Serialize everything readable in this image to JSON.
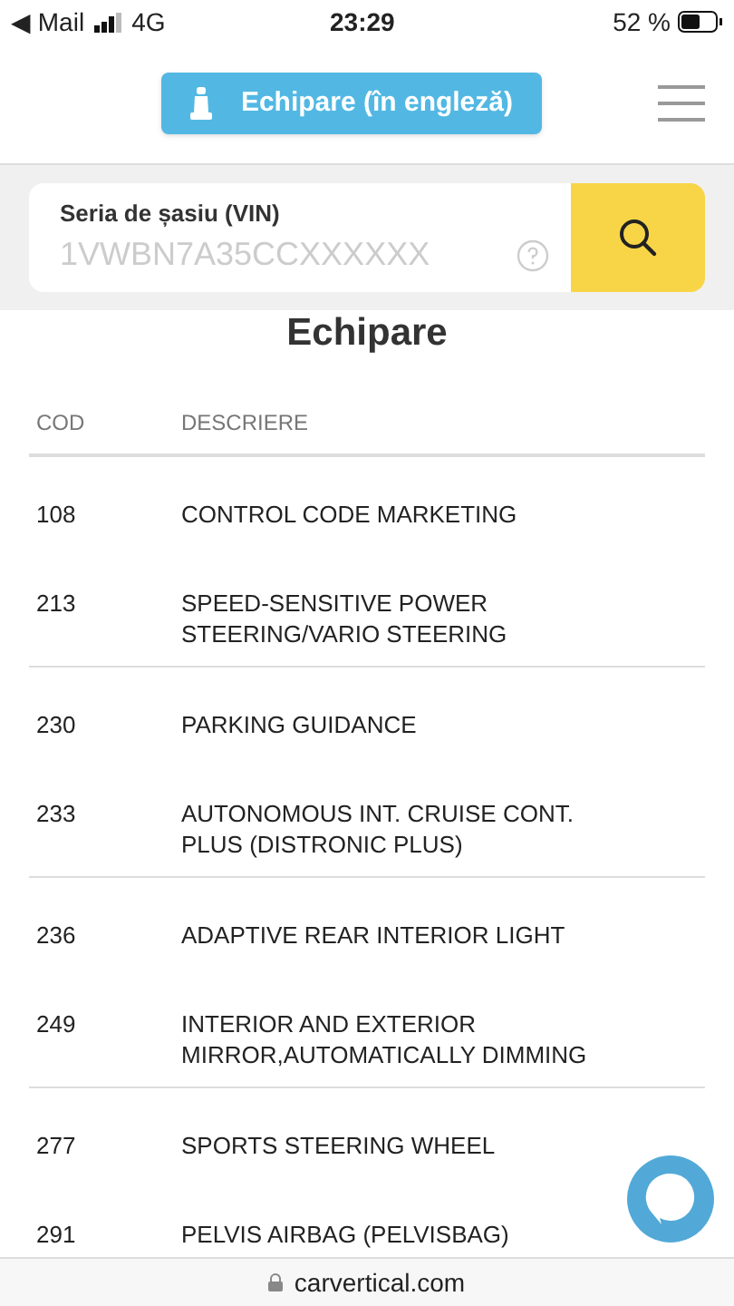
{
  "status_bar": {
    "back_app": "◀ Mail",
    "network": "4G",
    "time": "23:29",
    "battery": "52 %"
  },
  "header": {
    "button": "Echipare (în engleză)"
  },
  "search": {
    "label": "Seria de șasiu (VIN)",
    "placeholder": "1VWBN7A35CCXXXXXX"
  },
  "title": "Echipare",
  "table": {
    "columns": [
      "COD",
      "DESCRIERE"
    ],
    "rows": [
      {
        "code": "108",
        "description": "CONTROL CODE MARKETING"
      },
      {
        "code": "213",
        "description": "SPEED-SENSITIVE POWER STEERING/VARIO STEERING"
      },
      {
        "code": "230",
        "description": "PARKING GUIDANCE"
      },
      {
        "code": "233",
        "description": "AUTONOMOUS INT. CRUISE CONT. PLUS (DISTRONIC PLUS)"
      },
      {
        "code": "236",
        "description": "ADAPTIVE REAR INTERIOR LIGHT"
      },
      {
        "code": "249",
        "description": "INTERIOR AND EXTERIOR MIRROR,AUTOMATICALLY DIMMING"
      },
      {
        "code": "277",
        "description": "SPORTS STEERING WHEEL"
      },
      {
        "code": "291",
        "description": "PELVIS AIRBAG (PELVISBAG)"
      }
    ]
  },
  "address_bar": {
    "url": "carvertical.com"
  }
}
